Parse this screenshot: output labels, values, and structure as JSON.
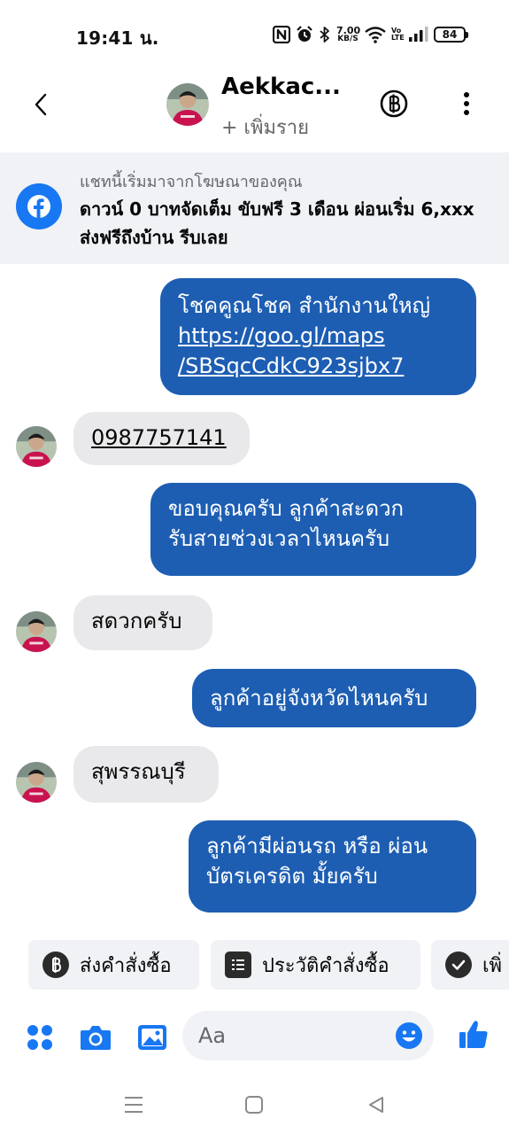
{
  "status_bar": {
    "time": "19:41 น.",
    "net_speed_value": "7.00",
    "net_speed_unit": "KB/S",
    "volte_top": "Vo",
    "volte_bottom": "LTE",
    "battery": "84"
  },
  "header": {
    "contact_name": "Aekkac...",
    "add_member": "+ เพิ่มราย"
  },
  "ad_banner": {
    "source_text": "แชทนี้เริ่มมาจากโฆษณาของคุณ",
    "ad_text": "ดาวน์ 0 บาทจัดเต็ม ขับฟรี 3 เดือน ผ่อนเริ่ม 6,xxx ส่งฟรีถึงบ้าน รีบเลย"
  },
  "messages": {
    "m1_line1": "โชคคูณโชค สำนักงานใหญ่",
    "m1_link_line1": "https://goo.gl/maps",
    "m1_link_line2": "/SBSqcCdkC923sjbx7",
    "m2_phone": "0987757141",
    "m3_line1": "ขอบคุณครับ ลูกค้าสะดวก",
    "m3_line2": "รับสายช่วงเวลาไหนครับ",
    "m4": "สดวกครับ",
    "m5": "ลูกค้าอยู่จังหวัดไหนครับ",
    "m6": "สุพรรณบุรี",
    "m7_line1": "ลูกค้ามีผ่อนรถ หรือ ผ่อน",
    "m7_line2": "บัตรเครดิต มั้ยครับ"
  },
  "quick_actions": {
    "send_order": "ส่งคำสั่งซื้อ",
    "order_history": "ประวัติคำสั่งซื้อ",
    "third": "เพิ่"
  },
  "composer": {
    "placeholder": "Aa"
  },
  "colors": {
    "outgoing_bubble": "#1d5eb3",
    "incoming_bubble": "#e9e9eb",
    "accent": "#1877f2",
    "banner_bg": "#f0f2f5"
  },
  "icons": {
    "back": "chevron-left-icon",
    "baht": "baht-icon",
    "more": "more-vertical-icon",
    "facebook": "facebook-icon",
    "apps": "apps-grid-icon",
    "camera": "camera-icon",
    "gallery": "gallery-icon",
    "emoji": "emoji-icon",
    "like": "thumbs-up-icon"
  }
}
